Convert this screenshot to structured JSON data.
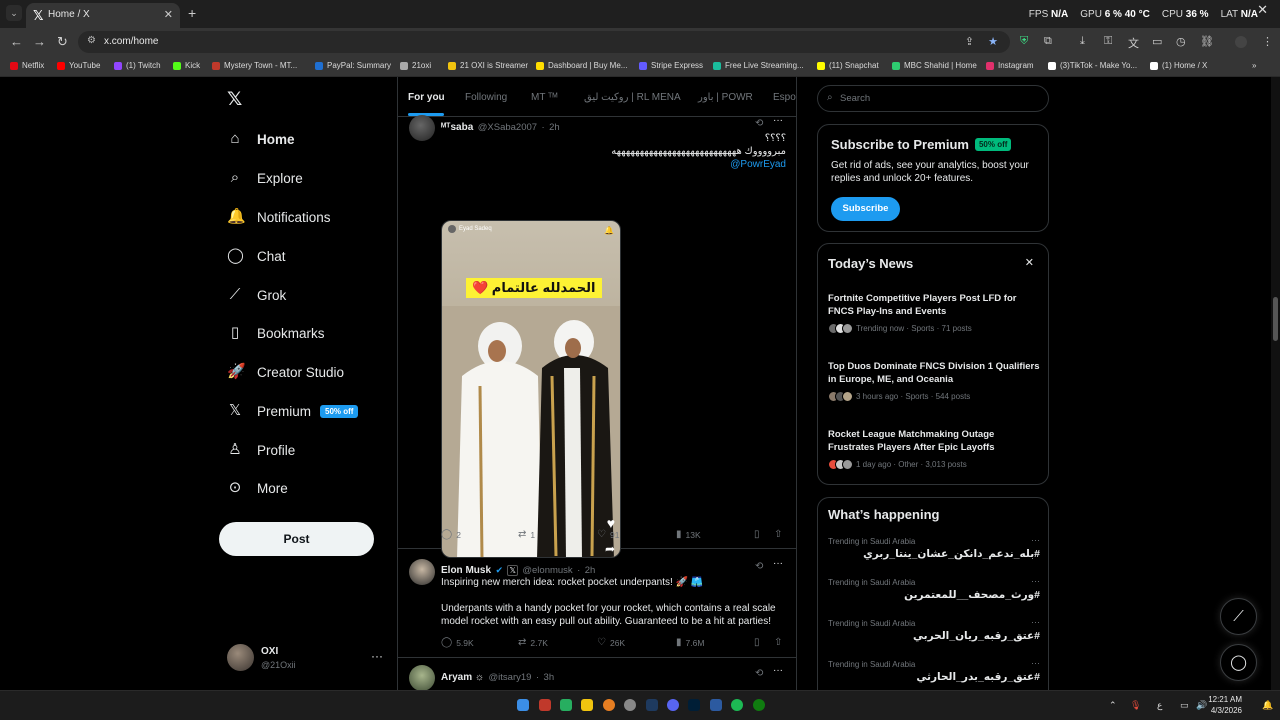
{
  "browser": {
    "tab_title": "Home / X",
    "url": "x.com/home",
    "overlay": {
      "fps_label": "FPS",
      "fps_value": "N/A",
      "gpu_label": "GPU",
      "gpu_value": "6 %",
      "gpu_temp": "40 °C",
      "cpu_label": "CPU",
      "cpu_value": "36 %",
      "lat_label": "LAT",
      "lat_value": "N/A"
    },
    "bookmarks": [
      {
        "label": "Netflix",
        "color": "#e50914"
      },
      {
        "label": "YouTube",
        "color": "#ff0000"
      },
      {
        "label": "(1) Twitch",
        "color": "#9146ff"
      },
      {
        "label": "Kick",
        "color": "#53fc18"
      },
      {
        "label": "Mystery Town - MT...",
        "color": "#c0392b"
      },
      {
        "label": "PayPal: Summary",
        "color": "#1f6fd1"
      },
      {
        "label": "21oxi",
        "color": "#aaaaaa"
      },
      {
        "label": "21 OXI is Streamer",
        "color": "#f1c40f"
      },
      {
        "label": "Dashboard | Buy Me...",
        "color": "#ffdd00"
      },
      {
        "label": "Stripe Express",
        "color": "#635bff"
      },
      {
        "label": "Free Live Streaming...",
        "color": "#1abc9c"
      },
      {
        "label": "(11) Snapchat",
        "color": "#fffc00"
      },
      {
        "label": "MBC Shahid | Home",
        "color": "#2ecc71"
      },
      {
        "label": "Instagram",
        "color": "#e1306c"
      },
      {
        "label": "(3)TikTok - Make Yo...",
        "color": "#ffffff"
      },
      {
        "label": "(1) Home / X",
        "color": "#ffffff"
      }
    ]
  },
  "nav": {
    "items": [
      {
        "label": "Home",
        "icon": "home-icon"
      },
      {
        "label": "Explore",
        "icon": "search-icon"
      },
      {
        "label": "Notifications",
        "icon": "bell-icon"
      },
      {
        "label": "Chat",
        "icon": "chat-icon"
      },
      {
        "label": "Grok",
        "icon": "grok-icon"
      },
      {
        "label": "Bookmarks",
        "icon": "bookmark-icon"
      },
      {
        "label": "Creator Studio",
        "icon": "rocket-icon"
      },
      {
        "label": "Premium",
        "icon": "x-logo-icon",
        "badge": "50% off"
      },
      {
        "label": "Profile",
        "icon": "person-icon"
      },
      {
        "label": "More",
        "icon": "more-circle-icon"
      }
    ],
    "post_label": "Post",
    "account": {
      "name": "OXI",
      "handle": "@21Oxii"
    }
  },
  "timeline": {
    "tabs": [
      "For you",
      "Following",
      "MT ᵀᴹ",
      "روكيت ليق | RL MENA",
      "باور | POWR",
      "Espor"
    ],
    "tweets": [
      {
        "author": "ᴹᵀsaba",
        "handle": "@XSaba2007",
        "time": "2h",
        "text_lines": [
          "؟؟؟؟",
          "مبرووووك هههههههههههههههههههههههههههه"
        ],
        "mention": "@PowrEyad",
        "media_title": "الحمدلله عالتمام ❤️",
        "media_user": "Eyad Sadeq",
        "stats": {
          "replies": "2",
          "reposts": "1",
          "likes": "91",
          "views": "13K"
        }
      },
      {
        "author": "Elon Musk",
        "handle": "@elonmusk",
        "time": "2h",
        "text_lines": [
          "Inspiring new merch idea: rocket pocket underpants! 🚀 🩳"
        ],
        "paragraph": "Underpants with a handy pocket for your rocket, which contains a real scale model rocket with an easy pull out ability. Guaranteed to be a hit at parties!",
        "stats": {
          "replies": "5.9K",
          "reposts": "2.7K",
          "likes": "26K",
          "views": "7.6M"
        }
      },
      {
        "author": "Aryam ☼",
        "handle": "@itsary19",
        "time": "3h"
      }
    ]
  },
  "sidebar": {
    "search_placeholder": "Search",
    "premium": {
      "title": "Subscribe to Premium",
      "badge": "50% off",
      "desc": "Get rid of ads, see your analytics, boost your replies and unlock 20+ features.",
      "button": "Subscribe"
    },
    "news": {
      "title": "Today’s News",
      "items": [
        {
          "title": "Fortnite Competitive Players Post LFD for FNCS Play-Ins and Events",
          "meta": "Trending now · Sports · 71 posts"
        },
        {
          "title": "Top Duos Dominate FNCS Division 1 Qualifiers in Europe, ME, and Oceania",
          "meta": "3 hours ago · Sports · 544 posts"
        },
        {
          "title": "Rocket League Matchmaking Outage Frustrates Players After Epic Layoffs",
          "meta": "1 day ago · Other · 3,013 posts"
        }
      ]
    },
    "happening": {
      "title": "What’s happening",
      "trends": [
        {
          "context": "Trending in Saudi Arabia",
          "name": "#بله_ندعم_دانكن_عشان_ينتا_ربري"
        },
        {
          "context": "Trending in Saudi Arabia",
          "name": "#ورث_مصحف__للمعتمرين"
        },
        {
          "context": "Trending in Saudi Arabia",
          "name": "#عتق_رقبه_ريان_الحربي"
        },
        {
          "context": "Trending in Saudi Arabia",
          "name": "#عتق_رقبه_بدر_الحارثي"
        }
      ]
    }
  },
  "taskbar": {
    "time": "12:21 AM",
    "date": "4/3/2026",
    "lang": "ع"
  },
  "colors": {
    "accent": "#1d9bf0",
    "offer": "#00ba7c",
    "background": "#000000"
  }
}
